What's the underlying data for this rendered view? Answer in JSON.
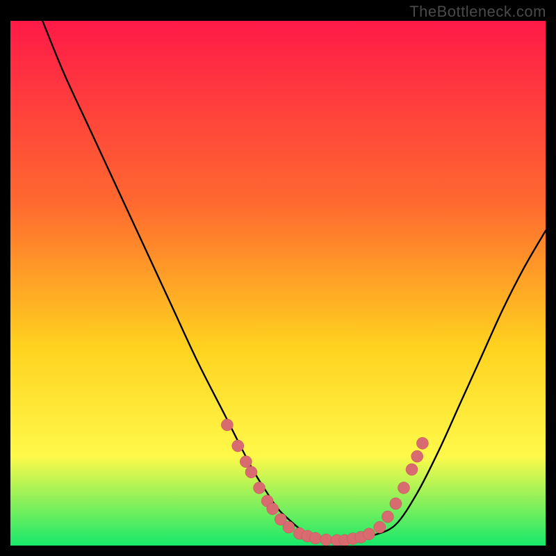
{
  "watermark": "TheBottleneck.com",
  "colors": {
    "frame": "#000000",
    "gradient_top": "#ff1a48",
    "gradient_mid1": "#ff6a2f",
    "gradient_mid2": "#ffd21f",
    "gradient_mid3": "#fff94a",
    "gradient_bottom": "#17e86b",
    "curve": "#000000",
    "marker_fill": "#d86b6f",
    "marker_stroke": "#c54f55"
  },
  "chart_data": {
    "type": "line",
    "title": "",
    "xlabel": "",
    "ylabel": "",
    "xlim": [
      0,
      100
    ],
    "ylim": [
      0,
      100
    ],
    "grid": false,
    "legend": false,
    "series": [
      {
        "name": "curve",
        "x": [
          6,
          10,
          15,
          20,
          25,
          30,
          35,
          40,
          45,
          48,
          50,
          52,
          55,
          58,
          60,
          62,
          65,
          68,
          72,
          76,
          80,
          84,
          88,
          92,
          96,
          100
        ],
        "y": [
          100,
          90,
          79,
          68,
          57,
          46,
          35,
          25,
          15,
          10,
          7,
          5,
          2.5,
          1.5,
          1,
          1,
          1.2,
          2,
          4,
          10,
          18,
          27,
          36,
          45,
          53,
          60
        ]
      }
    ],
    "markers": [
      {
        "x": 40.5,
        "y": 23
      },
      {
        "x": 42.5,
        "y": 19
      },
      {
        "x": 44,
        "y": 16
      },
      {
        "x": 45,
        "y": 14
      },
      {
        "x": 46.5,
        "y": 11
      },
      {
        "x": 48,
        "y": 8.5
      },
      {
        "x": 49,
        "y": 7
      },
      {
        "x": 50.5,
        "y": 5
      },
      {
        "x": 52,
        "y": 3.5
      },
      {
        "x": 54,
        "y": 2.3
      },
      {
        "x": 55.5,
        "y": 1.8
      },
      {
        "x": 57,
        "y": 1.4
      },
      {
        "x": 59,
        "y": 1.1
      },
      {
        "x": 61,
        "y": 1
      },
      {
        "x": 62.5,
        "y": 1
      },
      {
        "x": 64,
        "y": 1.3
      },
      {
        "x": 65.5,
        "y": 1.6
      },
      {
        "x": 67,
        "y": 2.2
      },
      {
        "x": 69,
        "y": 3.5
      },
      {
        "x": 70.5,
        "y": 5.5
      },
      {
        "x": 72,
        "y": 8
      },
      {
        "x": 73.5,
        "y": 11
      },
      {
        "x": 75,
        "y": 14.5
      },
      {
        "x": 76,
        "y": 17
      },
      {
        "x": 77,
        "y": 19.5
      }
    ]
  }
}
